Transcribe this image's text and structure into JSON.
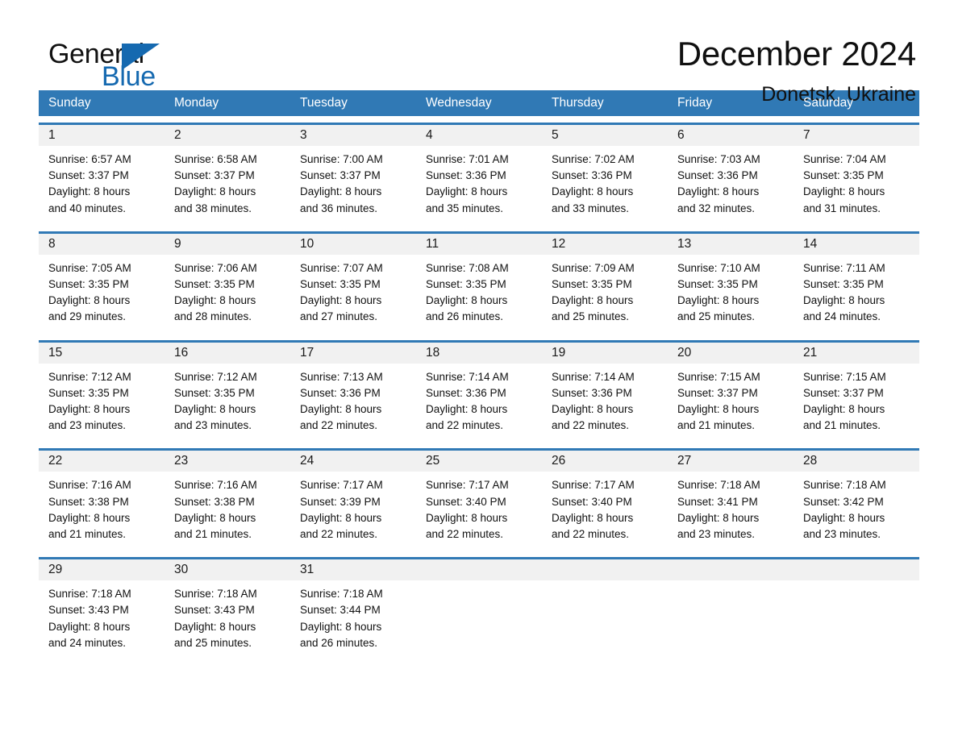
{
  "brand": {
    "name_part1": "General",
    "name_part2": "Blue",
    "triangle_color": "#1569b0",
    "accent_color": "#3079b5"
  },
  "header": {
    "title": "December 2024",
    "location": "Donetsk, Ukraine"
  },
  "weekday_headers": [
    "Sunday",
    "Monday",
    "Tuesday",
    "Wednesday",
    "Thursday",
    "Friday",
    "Saturday"
  ],
  "weeks": [
    [
      {
        "day": "1",
        "sunrise": "Sunrise: 6:57 AM",
        "sunset": "Sunset: 3:37 PM",
        "daylight_line1": "Daylight: 8 hours",
        "daylight_line2": "and 40 minutes."
      },
      {
        "day": "2",
        "sunrise": "Sunrise: 6:58 AM",
        "sunset": "Sunset: 3:37 PM",
        "daylight_line1": "Daylight: 8 hours",
        "daylight_line2": "and 38 minutes."
      },
      {
        "day": "3",
        "sunrise": "Sunrise: 7:00 AM",
        "sunset": "Sunset: 3:37 PM",
        "daylight_line1": "Daylight: 8 hours",
        "daylight_line2": "and 36 minutes."
      },
      {
        "day": "4",
        "sunrise": "Sunrise: 7:01 AM",
        "sunset": "Sunset: 3:36 PM",
        "daylight_line1": "Daylight: 8 hours",
        "daylight_line2": "and 35 minutes."
      },
      {
        "day": "5",
        "sunrise": "Sunrise: 7:02 AM",
        "sunset": "Sunset: 3:36 PM",
        "daylight_line1": "Daylight: 8 hours",
        "daylight_line2": "and 33 minutes."
      },
      {
        "day": "6",
        "sunrise": "Sunrise: 7:03 AM",
        "sunset": "Sunset: 3:36 PM",
        "daylight_line1": "Daylight: 8 hours",
        "daylight_line2": "and 32 minutes."
      },
      {
        "day": "7",
        "sunrise": "Sunrise: 7:04 AM",
        "sunset": "Sunset: 3:35 PM",
        "daylight_line1": "Daylight: 8 hours",
        "daylight_line2": "and 31 minutes."
      }
    ],
    [
      {
        "day": "8",
        "sunrise": "Sunrise: 7:05 AM",
        "sunset": "Sunset: 3:35 PM",
        "daylight_line1": "Daylight: 8 hours",
        "daylight_line2": "and 29 minutes."
      },
      {
        "day": "9",
        "sunrise": "Sunrise: 7:06 AM",
        "sunset": "Sunset: 3:35 PM",
        "daylight_line1": "Daylight: 8 hours",
        "daylight_line2": "and 28 minutes."
      },
      {
        "day": "10",
        "sunrise": "Sunrise: 7:07 AM",
        "sunset": "Sunset: 3:35 PM",
        "daylight_line1": "Daylight: 8 hours",
        "daylight_line2": "and 27 minutes."
      },
      {
        "day": "11",
        "sunrise": "Sunrise: 7:08 AM",
        "sunset": "Sunset: 3:35 PM",
        "daylight_line1": "Daylight: 8 hours",
        "daylight_line2": "and 26 minutes."
      },
      {
        "day": "12",
        "sunrise": "Sunrise: 7:09 AM",
        "sunset": "Sunset: 3:35 PM",
        "daylight_line1": "Daylight: 8 hours",
        "daylight_line2": "and 25 minutes."
      },
      {
        "day": "13",
        "sunrise": "Sunrise: 7:10 AM",
        "sunset": "Sunset: 3:35 PM",
        "daylight_line1": "Daylight: 8 hours",
        "daylight_line2": "and 25 minutes."
      },
      {
        "day": "14",
        "sunrise": "Sunrise: 7:11 AM",
        "sunset": "Sunset: 3:35 PM",
        "daylight_line1": "Daylight: 8 hours",
        "daylight_line2": "and 24 minutes."
      }
    ],
    [
      {
        "day": "15",
        "sunrise": "Sunrise: 7:12 AM",
        "sunset": "Sunset: 3:35 PM",
        "daylight_line1": "Daylight: 8 hours",
        "daylight_line2": "and 23 minutes."
      },
      {
        "day": "16",
        "sunrise": "Sunrise: 7:12 AM",
        "sunset": "Sunset: 3:35 PM",
        "daylight_line1": "Daylight: 8 hours",
        "daylight_line2": "and 23 minutes."
      },
      {
        "day": "17",
        "sunrise": "Sunrise: 7:13 AM",
        "sunset": "Sunset: 3:36 PM",
        "daylight_line1": "Daylight: 8 hours",
        "daylight_line2": "and 22 minutes."
      },
      {
        "day": "18",
        "sunrise": "Sunrise: 7:14 AM",
        "sunset": "Sunset: 3:36 PM",
        "daylight_line1": "Daylight: 8 hours",
        "daylight_line2": "and 22 minutes."
      },
      {
        "day": "19",
        "sunrise": "Sunrise: 7:14 AM",
        "sunset": "Sunset: 3:36 PM",
        "daylight_line1": "Daylight: 8 hours",
        "daylight_line2": "and 22 minutes."
      },
      {
        "day": "20",
        "sunrise": "Sunrise: 7:15 AM",
        "sunset": "Sunset: 3:37 PM",
        "daylight_line1": "Daylight: 8 hours",
        "daylight_line2": "and 21 minutes."
      },
      {
        "day": "21",
        "sunrise": "Sunrise: 7:15 AM",
        "sunset": "Sunset: 3:37 PM",
        "daylight_line1": "Daylight: 8 hours",
        "daylight_line2": "and 21 minutes."
      }
    ],
    [
      {
        "day": "22",
        "sunrise": "Sunrise: 7:16 AM",
        "sunset": "Sunset: 3:38 PM",
        "daylight_line1": "Daylight: 8 hours",
        "daylight_line2": "and 21 minutes."
      },
      {
        "day": "23",
        "sunrise": "Sunrise: 7:16 AM",
        "sunset": "Sunset: 3:38 PM",
        "daylight_line1": "Daylight: 8 hours",
        "daylight_line2": "and 21 minutes."
      },
      {
        "day": "24",
        "sunrise": "Sunrise: 7:17 AM",
        "sunset": "Sunset: 3:39 PM",
        "daylight_line1": "Daylight: 8 hours",
        "daylight_line2": "and 22 minutes."
      },
      {
        "day": "25",
        "sunrise": "Sunrise: 7:17 AM",
        "sunset": "Sunset: 3:40 PM",
        "daylight_line1": "Daylight: 8 hours",
        "daylight_line2": "and 22 minutes."
      },
      {
        "day": "26",
        "sunrise": "Sunrise: 7:17 AM",
        "sunset": "Sunset: 3:40 PM",
        "daylight_line1": "Daylight: 8 hours",
        "daylight_line2": "and 22 minutes."
      },
      {
        "day": "27",
        "sunrise": "Sunrise: 7:18 AM",
        "sunset": "Sunset: 3:41 PM",
        "daylight_line1": "Daylight: 8 hours",
        "daylight_line2": "and 23 minutes."
      },
      {
        "day": "28",
        "sunrise": "Sunrise: 7:18 AM",
        "sunset": "Sunset: 3:42 PM",
        "daylight_line1": "Daylight: 8 hours",
        "daylight_line2": "and 23 minutes."
      }
    ],
    [
      {
        "day": "29",
        "sunrise": "Sunrise: 7:18 AM",
        "sunset": "Sunset: 3:43 PM",
        "daylight_line1": "Daylight: 8 hours",
        "daylight_line2": "and 24 minutes."
      },
      {
        "day": "30",
        "sunrise": "Sunrise: 7:18 AM",
        "sunset": "Sunset: 3:43 PM",
        "daylight_line1": "Daylight: 8 hours",
        "daylight_line2": "and 25 minutes."
      },
      {
        "day": "31",
        "sunrise": "Sunrise: 7:18 AM",
        "sunset": "Sunset: 3:44 PM",
        "daylight_line1": "Daylight: 8 hours",
        "daylight_line2": "and 26 minutes."
      },
      {
        "day": "",
        "sunrise": "",
        "sunset": "",
        "daylight_line1": "",
        "daylight_line2": ""
      },
      {
        "day": "",
        "sunrise": "",
        "sunset": "",
        "daylight_line1": "",
        "daylight_line2": ""
      },
      {
        "day": "",
        "sunrise": "",
        "sunset": "",
        "daylight_line1": "",
        "daylight_line2": ""
      },
      {
        "day": "",
        "sunrise": "",
        "sunset": "",
        "daylight_line1": "",
        "daylight_line2": ""
      }
    ]
  ]
}
